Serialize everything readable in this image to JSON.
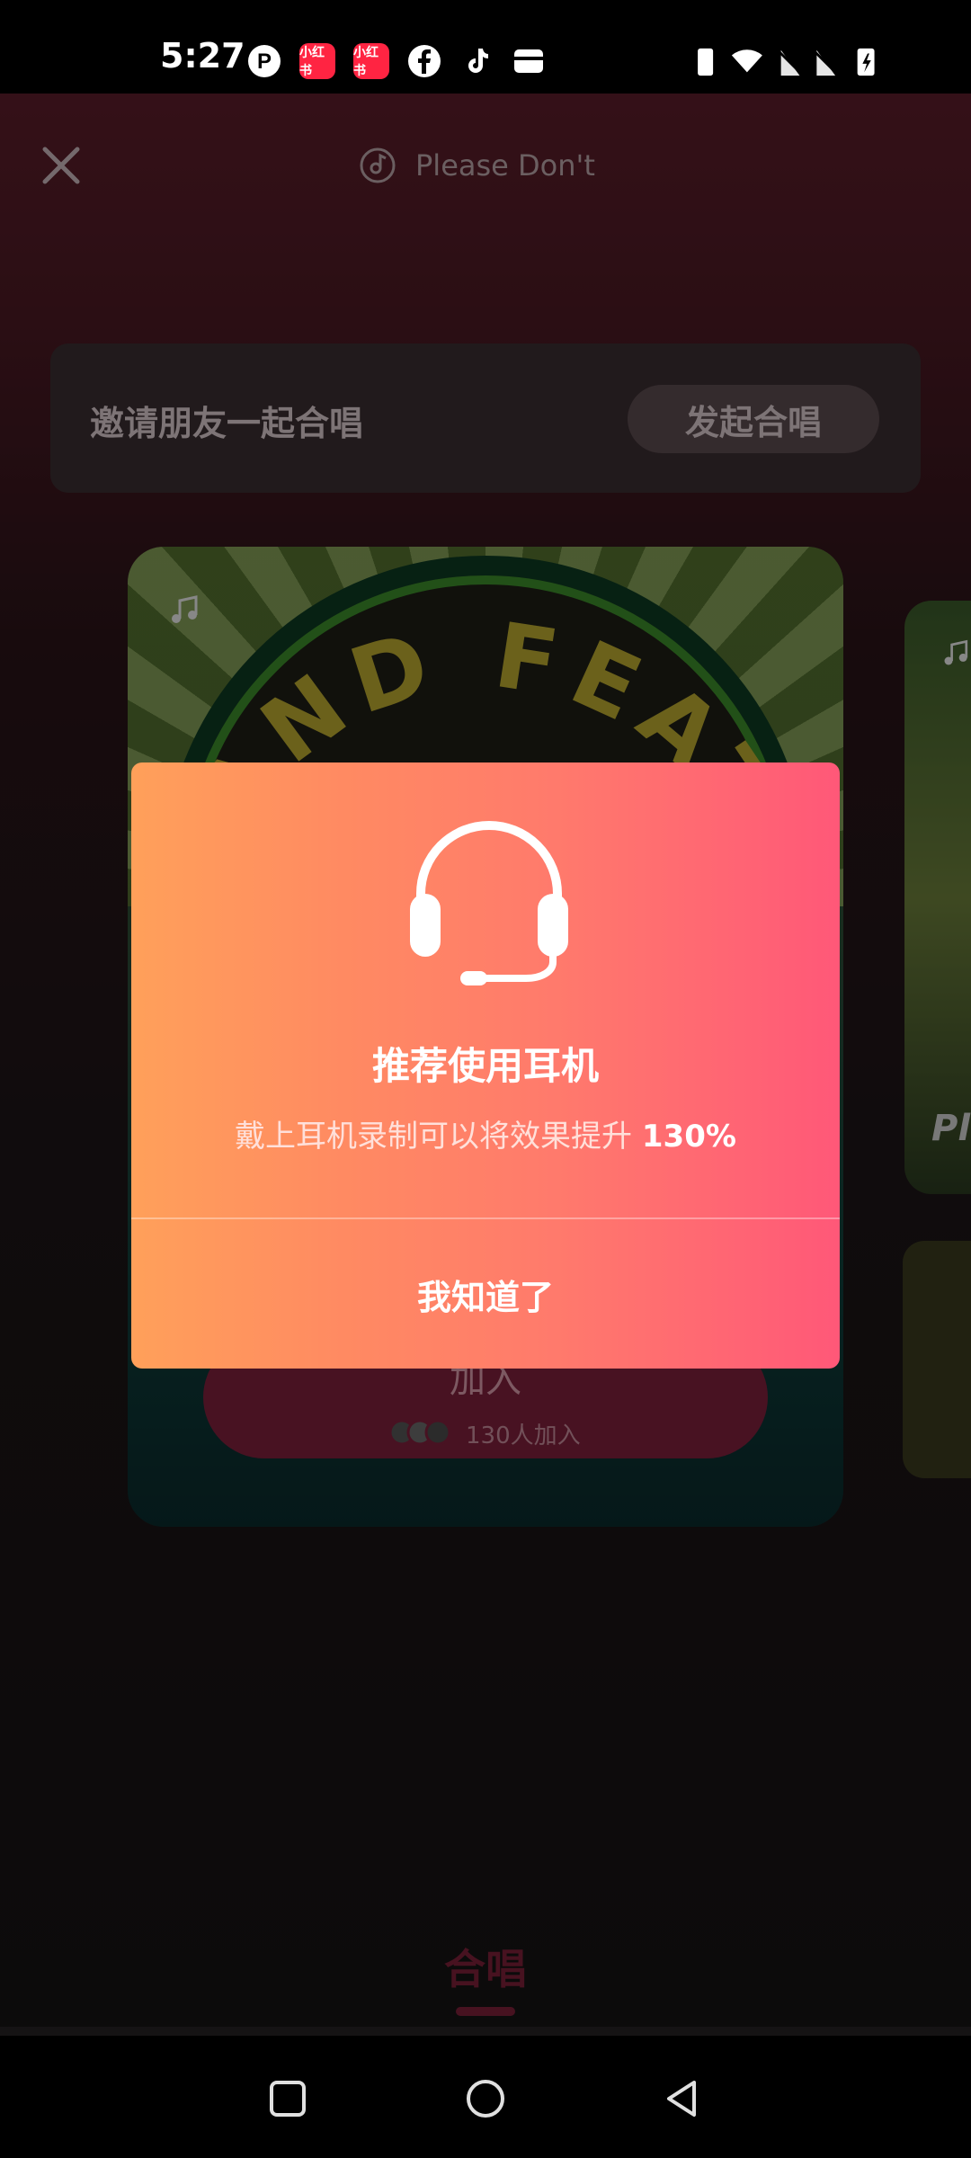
{
  "status_bar": {
    "time": "5:27",
    "icons": [
      "pinterest-icon",
      "xiaohongshu-icon",
      "xiaohongshu-icon",
      "facebook-icon",
      "tiktok-icon",
      "wallet-icon",
      "vibrate-icon",
      "wifi-icon",
      "no-sim-icon",
      "no-sim-icon",
      "battery-charging-icon"
    ],
    "xhs_label": "小红书"
  },
  "header": {
    "song_title": "Please Don't"
  },
  "invite": {
    "label": "邀请朋友一起合唱",
    "start_button": "发起合唱"
  },
  "card": {
    "cover_text": "AND FEAT",
    "join_label": "加入",
    "join_count": "130人加入"
  },
  "card2": {
    "label": "Ple"
  },
  "dialog": {
    "title": "推荐使用耳机",
    "body_prefix": "戴上耳机录制可以将效果提升 ",
    "body_value": "130%",
    "ack_button": "我知道了"
  },
  "tabs": {
    "chorus": "合唱"
  },
  "colors": {
    "accent": "#7a2038",
    "dialog_start": "#ffa05a",
    "dialog_end": "#ff5878"
  }
}
